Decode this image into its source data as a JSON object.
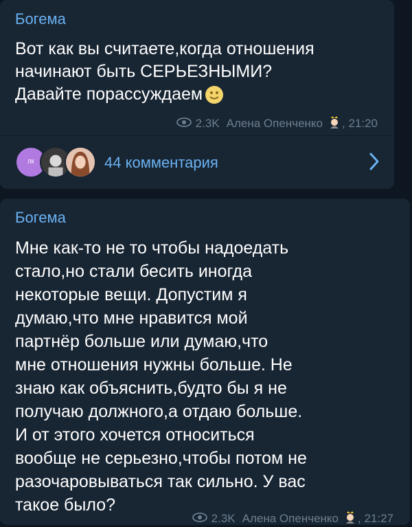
{
  "posts": [
    {
      "channel": "Богема",
      "lines": [
        "Вот как вы считаете,когда отношения",
        "начинают быть СЕРЬЕЗНЫМИ?",
        "Давайте порассуждаем"
      ],
      "views": "2.3K",
      "author": "Алена Опенченко",
      "time": "21:20"
    },
    {
      "channel": "Богема",
      "lines": [
        "Мне как-то не то чтобы надоедать",
        "стало,но стали бесить иногда",
        "некоторые вещи. Допустим я",
        "думаю,что мне нравится мой",
        "партнёр больше или думаю,что",
        "мне отношения нужны больше. Не",
        "знаю как объяснить,будто бы я не",
        "получаю должного,а отдаю больше.",
        "И от этого хочется относиться",
        "вообще не серьезно,чтобы потом не",
        "разочаровываться так сильно. У вас",
        "такое было?"
      ],
      "views": "2.3K",
      "author": "Алена Опенченко",
      "time": "21:27"
    }
  ],
  "comments": {
    "label": "44 комментария",
    "avatar1_text": "ЛК"
  },
  "icons": {
    "views": "eye-icon",
    "author_emoji": "princess-emoji-icon",
    "inline_emoji": "smiley-moon-emoji-icon",
    "chevron": "chevron-right-icon"
  },
  "colors": {
    "background": "#0e1621",
    "bubble": "#182533",
    "accent": "#6ab2f2",
    "meta": "#6d7f8f",
    "text": "#ffffff"
  }
}
